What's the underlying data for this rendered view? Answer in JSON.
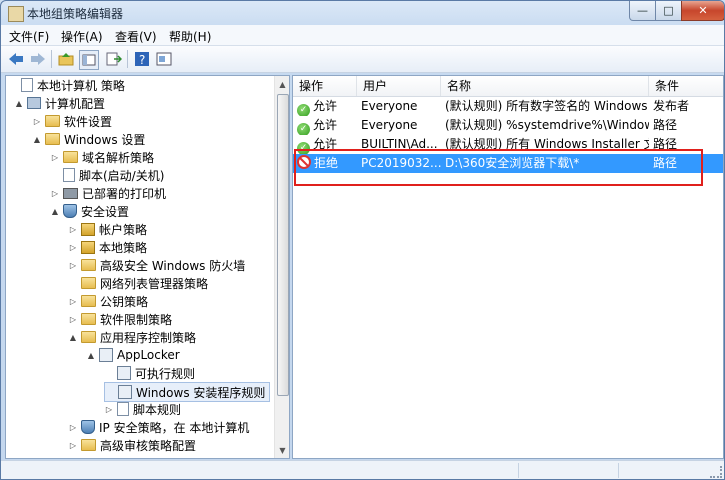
{
  "window": {
    "title": "本地组策略编辑器"
  },
  "menu": {
    "items": [
      {
        "label": "文件(F)"
      },
      {
        "label": "操作(A)"
      },
      {
        "label": "查看(V)"
      },
      {
        "label": "帮助(H)"
      }
    ]
  },
  "tree": {
    "items": [
      {
        "label": "本地计算机 策略",
        "icon": "document-icon",
        "twisty": ""
      },
      {
        "label": "计算机配置",
        "icon": "computer-icon",
        "twisty": "▲"
      },
      {
        "label": "软件设置",
        "icon": "folder-icon",
        "twisty": "▷"
      },
      {
        "label": "Windows 设置",
        "icon": "folder-icon",
        "twisty": "▲"
      },
      {
        "label": "域名解析策略",
        "icon": "folder-icon",
        "twisty": "▷"
      },
      {
        "label": "脚本(启动/关机)",
        "icon": "script-icon",
        "twisty": ""
      },
      {
        "label": "已部署的打印机",
        "icon": "printer-icon",
        "twisty": "▷"
      },
      {
        "label": "安全设置",
        "icon": "security-icon",
        "twisty": "▲"
      },
      {
        "label": "帐户策略",
        "icon": "lock-folder-icon",
        "twisty": "▷"
      },
      {
        "label": "本地策略",
        "icon": "lock-folder-icon",
        "twisty": "▷"
      },
      {
        "label": "高级安全 Windows 防火墙",
        "icon": "folder-icon",
        "twisty": "▷"
      },
      {
        "label": "网络列表管理器策略",
        "icon": "folder-icon",
        "twisty": ""
      },
      {
        "label": "公钥策略",
        "icon": "folder-icon",
        "twisty": "▷"
      },
      {
        "label": "软件限制策略",
        "icon": "folder-icon",
        "twisty": "▷"
      },
      {
        "label": "应用程序控制策略",
        "icon": "folder-icon",
        "twisty": "▲"
      },
      {
        "label": "AppLocker",
        "icon": "applocker-icon",
        "twisty": "▲"
      },
      {
        "label": "可执行规则",
        "icon": "rules-icon",
        "twisty": ""
      },
      {
        "label": "Windows 安装程序规则",
        "icon": "installer-rules-icon",
        "twisty": ""
      },
      {
        "label": "脚本规则",
        "icon": "script-rules-icon",
        "twisty": "▷"
      },
      {
        "label": "IP 安全策略，在 本地计算机",
        "icon": "ip-security-icon",
        "twisty": "▷"
      },
      {
        "label": "高级审核策略配置",
        "icon": "folder-icon",
        "twisty": "▷"
      }
    ]
  },
  "table": {
    "columns": [
      "操作",
      "用户",
      "名称",
      "条件"
    ],
    "rows": [
      {
        "action": "允许",
        "user": "Everyone",
        "name": "(默认规则) 所有数字签名的 Windows I...",
        "condition": "发布者"
      },
      {
        "action": "允许",
        "user": "Everyone",
        "name": "(默认规则) %systemdrive%\\Windows...",
        "condition": "路径"
      },
      {
        "action": "允许",
        "user": "BUILTIN\\Ad...",
        "name": "(默认规则) 所有 Windows Installer 文...",
        "condition": "路径"
      },
      {
        "action": "拒绝",
        "user": "PC2019032...",
        "name": "D:\\360安全浏览器下载\\*",
        "condition": "路径"
      }
    ]
  },
  "colors": {
    "selection": "#3399ff",
    "highlight_box": "#e0201c",
    "allow": "#2f9a1c",
    "deny": "#dd3333"
  }
}
